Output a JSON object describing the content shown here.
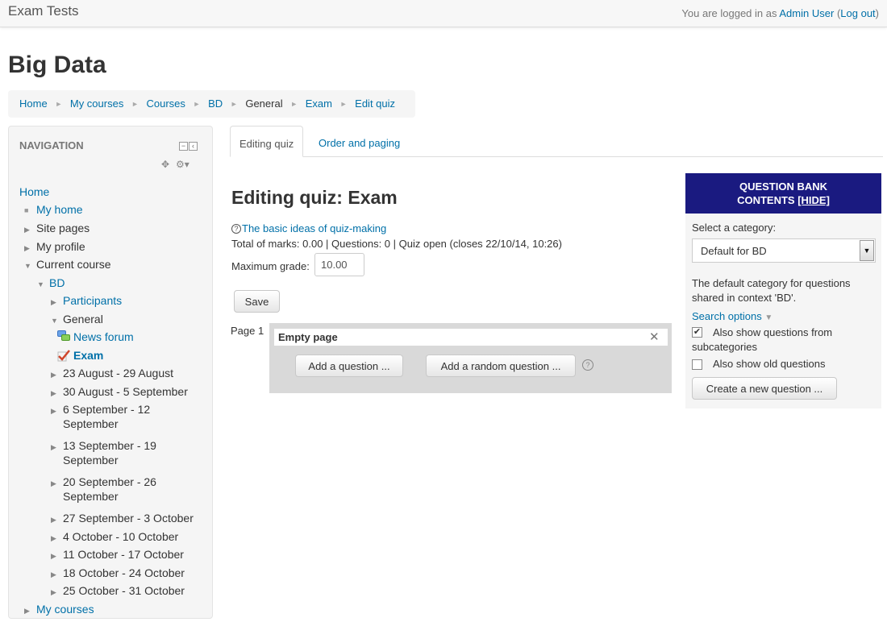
{
  "topbar": {
    "site_name": "Exam Tests",
    "logged_in_prefix": "You are logged in as",
    "user_name": "Admin User",
    "logout_open": "(",
    "logout_label": "Log out",
    "logout_close": ")"
  },
  "course_title": "Big Data",
  "breadcrumb": {
    "items": [
      "Home",
      "My courses",
      "Courses",
      "BD",
      "General",
      "Exam",
      "Edit quiz"
    ],
    "separator": "►"
  },
  "navigation": {
    "title": "NAVIGATION",
    "items": [
      {
        "label": "Home"
      },
      {
        "label": "My home"
      },
      {
        "label": "Site pages"
      },
      {
        "label": "My profile"
      },
      {
        "label": "Current course"
      },
      {
        "label": "BD"
      },
      {
        "label": "Participants"
      },
      {
        "label": "General"
      },
      {
        "label": "News forum"
      },
      {
        "label": "Exam"
      },
      {
        "label": "23 August - 29 August"
      },
      {
        "label": "30 August - 5 September"
      },
      {
        "label": "6 September - 12 September"
      },
      {
        "label": "13 September - 19 September"
      },
      {
        "label": "20 September - 26 September"
      },
      {
        "label": "27 September - 3 October"
      },
      {
        "label": "4 October - 10 October"
      },
      {
        "label": "11 October - 17 October"
      },
      {
        "label": "18 October - 24 October"
      },
      {
        "label": "25 October - 31 October"
      },
      {
        "label": "My courses"
      }
    ]
  },
  "tabs": [
    {
      "label": "Editing quiz",
      "active": true
    },
    {
      "label": "Order and paging",
      "active": false
    }
  ],
  "main": {
    "heading": "Editing quiz: Exam",
    "help_link": "The basic ideas of quiz-making",
    "status": "Total of marks: 0.00 | Questions: 0 | Quiz open (closes 22/10/14, 10:26)",
    "max_grade_label": "Maximum grade:",
    "max_grade_value": "10.00",
    "save_label": "Save",
    "page_label": "Page 1",
    "empty_page_label": "Empty page",
    "add_question_label": "Add a question ...",
    "add_random_label": "Add a random question ..."
  },
  "question_bank": {
    "header_line1": "QUESTION BANK",
    "header_line2": "CONTENTS",
    "hide_label": "[HIDE]",
    "select_label": "Select a category:",
    "selected_category": "Default for BD",
    "description": "The default category for questions shared in context 'BD'.",
    "search_options_label": "Search options",
    "subcategories_label": "Also show questions from subcategories",
    "subcategories_checked": true,
    "old_questions_label": "Also show old questions",
    "old_questions_checked": false,
    "create_label": "Create a new question ..."
  },
  "icons": {
    "expanded": "triangle-down",
    "collapsed": "triangle-right",
    "forum": "speech-bubbles",
    "quiz": "checkmark",
    "help": "question-circle",
    "close": "cross"
  },
  "colors": {
    "link": "#0070a8",
    "question_bank_header": "#1a1a80",
    "panel_gray": "#d9d9d9"
  }
}
